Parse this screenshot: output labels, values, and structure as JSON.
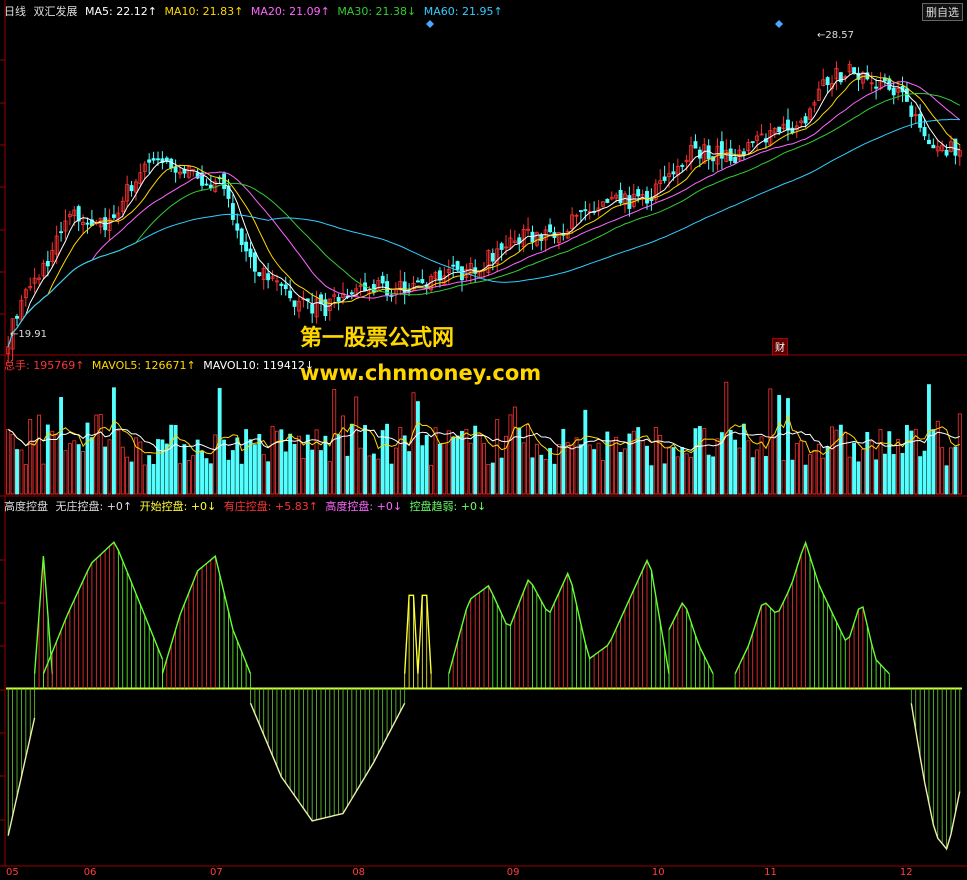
{
  "header": {
    "period": "日线",
    "stock": "双汇发展",
    "ma": [
      {
        "label": "MA5: 22.12↑",
        "color": "#ffffff"
      },
      {
        "label": "MA10: 21.83↑",
        "color": "#ffd700"
      },
      {
        "label": "MA20: 21.09↑",
        "color": "#ff66ff"
      },
      {
        "label": "MA30: 21.38↓",
        "color": "#33cc33"
      },
      {
        "label": "MA60: 21.95↑",
        "color": "#33ccff"
      }
    ],
    "button": "删自选"
  },
  "price_high": "28.57",
  "price_low": "19.91",
  "fin_badge": "财",
  "volume_header": {
    "title": "总手: ",
    "value": "195769↑",
    "mavol5": "MAVOL5: 126671↑",
    "mavol10": "MAVOL10: 119412↓"
  },
  "indicator_header": [
    {
      "label": "高度控盘",
      "color": "#dddddd"
    },
    {
      "label": "无庄控盘: +0↑",
      "color": "#dddddd"
    },
    {
      "label": "开始控盘: +0↓",
      "color": "#ffff33"
    },
    {
      "label": "有庄控盘: +5.83↑",
      "color": "#ff3333"
    },
    {
      "label": "高度控盘: +0↓",
      "color": "#ff66ff"
    },
    {
      "label": "控盘趋弱: +0↓",
      "color": "#66ff66"
    }
  ],
  "watermark": {
    "line1": "第一股票公式网",
    "line2": "www.chnmoney.com"
  },
  "x_labels": [
    {
      "label": "05",
      "pos": 0.0
    },
    {
      "label": "06",
      "pos": 0.083
    },
    {
      "label": "07",
      "pos": 0.218
    },
    {
      "label": "08",
      "pos": 0.37
    },
    {
      "label": "09",
      "pos": 0.535
    },
    {
      "label": "10",
      "pos": 0.69
    },
    {
      "label": "11",
      "pos": 0.81
    },
    {
      "label": "12",
      "pos": 0.955
    }
  ],
  "chart_data": {
    "type": "candlestick",
    "price_range": [
      19.5,
      29.3
    ],
    "close_trend": [
      [
        0,
        19.9
      ],
      [
        3,
        21.0
      ],
      [
        8,
        22.0
      ],
      [
        14,
        23.5
      ],
      [
        22,
        23.2
      ],
      [
        32,
        25.2
      ],
      [
        40,
        24.8
      ],
      [
        48,
        24.4
      ],
      [
        56,
        22.0
      ],
      [
        64,
        21.0
      ],
      [
        72,
        20.8
      ],
      [
        80,
        21.4
      ],
      [
        88,
        21.3
      ],
      [
        96,
        21.7
      ],
      [
        105,
        21.9
      ],
      [
        115,
        22.8
      ],
      [
        125,
        23.1
      ],
      [
        135,
        23.8
      ],
      [
        145,
        24.0
      ],
      [
        155,
        25.4
      ],
      [
        165,
        25.3
      ],
      [
        175,
        26.1
      ],
      [
        180,
        26.2
      ],
      [
        186,
        27.5
      ],
      [
        192,
        27.8
      ],
      [
        198,
        27.4
      ],
      [
        204,
        26.8
      ],
      [
        208,
        25.9
      ],
      [
        212,
        25.5
      ],
      [
        216,
        25.5
      ]
    ],
    "volume_range": [
      0,
      260000
    ],
    "indicator": {
      "range": [
        -1.2,
        1.2
      ],
      "segments": [
        {
          "from": 0,
          "to": 6,
          "type": "neg_green",
          "vals": [
            -1.0,
            -0.6,
            -0.2
          ]
        },
        {
          "from": 6,
          "to": 10,
          "type": "pos",
          "vals": [
            0.1,
            0.9,
            0.1
          ]
        },
        {
          "from": 8,
          "to": 35,
          "type": "pos",
          "vals": [
            0.1,
            0.5,
            0.85,
            1.0,
            0.6,
            0.2
          ]
        },
        {
          "from": 35,
          "to": 55,
          "type": "pos",
          "vals": [
            0.1,
            0.5,
            0.8,
            0.9,
            0.4,
            0.1
          ]
        },
        {
          "from": 55,
          "to": 90,
          "type": "neg_green",
          "vals": [
            -0.1,
            -0.6,
            -0.9,
            -0.85,
            -0.5,
            -0.1
          ]
        },
        {
          "from": 90,
          "to": 96,
          "type": "pos_yellow",
          "vals": [
            0.1,
            0.9,
            0.1,
            0.9,
            0.1
          ]
        },
        {
          "from": 100,
          "to": 150,
          "type": "pos",
          "vals": [
            0.1,
            0.6,
            0.7,
            0.4,
            0.75,
            0.5,
            0.8,
            0.2,
            0.3,
            0.6,
            0.9,
            0.1
          ]
        },
        {
          "from": 150,
          "to": 160,
          "type": "pos",
          "vals": [
            0.4,
            0.6,
            0.3,
            0.1
          ]
        },
        {
          "from": 165,
          "to": 200,
          "type": "pos",
          "vals": [
            0.1,
            0.3,
            0.6,
            0.5,
            0.7,
            1.0,
            0.7,
            0.5,
            0.3,
            0.6,
            0.2,
            0.1
          ]
        },
        {
          "from": 205,
          "to": 216,
          "type": "neg_green",
          "vals": [
            -0.1,
            -0.6,
            -1.0,
            -1.1,
            -0.7
          ]
        }
      ]
    }
  }
}
